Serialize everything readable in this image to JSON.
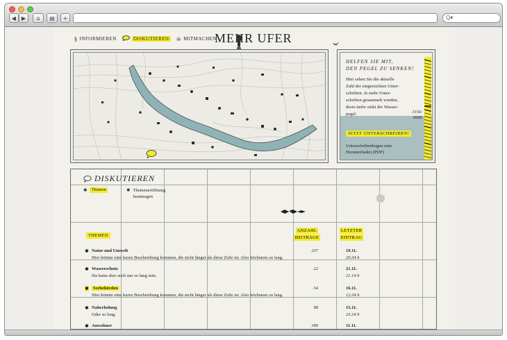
{
  "browser": {
    "search_icon_glyph": "Q▾",
    "buttons": [
      "◀",
      "▶",
      "⌂",
      "▤",
      "+"
    ]
  },
  "nav": {
    "items": [
      {
        "icon": "§",
        "label": "INFORMIEREN"
      },
      {
        "icon": "💬",
        "label": "DISKUTIEREN",
        "active": true
      },
      {
        "icon": "☠",
        "label": "MITMACHEN"
      }
    ]
  },
  "site": {
    "title": "MEHR UFER"
  },
  "petition": {
    "heading_1": "HELFEN SIE MIT,",
    "heading_2": "DEN PEGEL ZU SENKEN!",
    "text_lines": [
      "Hier sehen Sie die aktuelle",
      "Zahl der eingereichten Unter-",
      "schriften. Je mehr Unter-",
      "schriften gesammelt wurden,",
      "desto tiefer sinkt der Wasser-",
      "pegel."
    ],
    "count_current": "3156/",
    "count_total": "6000",
    "sign_button": "JETZT UNTERSCHREIBEN!",
    "download_1": "Unterschriftenbogen zum",
    "download_2": "Herunterladen (PDF)",
    "fill_fraction": 0.526
  },
  "discussion": {
    "heading": "DISKUTIEREN",
    "tab_active": "Themen",
    "tab_other_1": "Themeneröffnung",
    "tab_other_2": "beantragen",
    "col_topics": "THEMEN",
    "col_count_1": "ANZAHL",
    "col_count_2": "BEITRÄGE",
    "col_last_1": "LETZTER",
    "col_last_2": "EINTRAG",
    "rows": [
      {
        "title": "Natur und Umwelt",
        "desc": "Hier könnte eine kurze Beschreibung kommen, die nicht länger als diese Zeile ist. Also höchstens so lang.",
        "count": "237",
        "date": "19.11.",
        "time": "20.34 h",
        "highlight": false
      },
      {
        "title": "Wasserschutz",
        "desc": "Sie kann aber auch nur so lang sein.",
        "count": "22",
        "date": "21.11.",
        "time": "21.14 h",
        "highlight": false
      },
      {
        "title": "Seebehörden",
        "desc": "Hier könnte eine kurze Beschreibung kommen, die nicht länger als diese Zeile ist. Also höchstens so lang.",
        "count": "34",
        "date": "16.11.",
        "time": "12.34 h",
        "highlight": true
      },
      {
        "title": "Naherholung",
        "desc": "Oder so lang.",
        "count": "98",
        "date": "15.11.",
        "time": "23.24 h",
        "highlight": false
      },
      {
        "title": "Anwohner",
        "desc": "",
        "count": "180",
        "date": "11.11.",
        "time": "",
        "highlight": false
      }
    ]
  },
  "colors": {
    "accent_yellow": "#f3ea2c",
    "lake": "#8fb3b4",
    "panel_blue": "#a9bfc0",
    "paper": "#f2f1ec"
  }
}
